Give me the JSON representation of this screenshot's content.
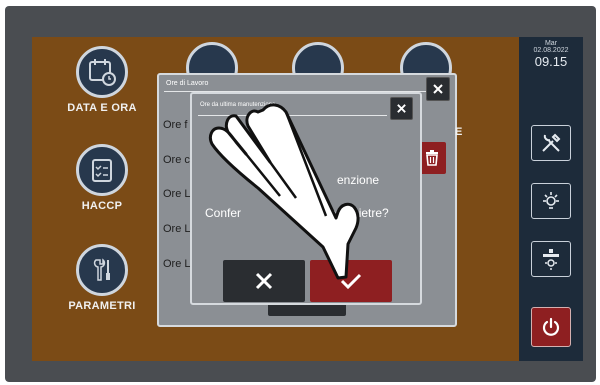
{
  "status": {
    "day": "Mar",
    "date": "02.08.2022",
    "time": "09.15"
  },
  "menu": {
    "date_time_label": "DATA E ORA",
    "haccp_label": "HACCP",
    "params_label": "PARAMETRI"
  },
  "dialog_hours": {
    "title": "Ore di Lavoro",
    "rows": [
      "Ore f",
      "Ore c",
      "Ore L",
      "Ore L",
      "Ore L"
    ],
    "bg_fragment": "E"
  },
  "dialog_confirm": {
    "title": "Ore da ultima manutenzione",
    "message_line1": "Confermi azzeramento ore manutenzione",
    "message_line1_visible": "enzione",
    "message_line2_left": "Confer",
    "message_line2_right": "sotto le pietre?"
  },
  "icons": {
    "calendar": "calendar-clock-icon",
    "checklist": "clipboard-checklist-icon",
    "tools": "wrench-screwdriver-icon",
    "tools_sidebar": "tools-icon",
    "light": "lamp-icon",
    "hood": "hood-light-icon",
    "power": "power-icon",
    "close": "close-icon",
    "trash": "trash-icon",
    "cancel": "x-icon",
    "confirm": "check-icon",
    "hand": "pointing-hand-icon"
  },
  "colors": {
    "background": "#7b4b16",
    "panel": "#8b8f94",
    "sidebar": "#1d2b3a",
    "accent_red": "#8e1f21",
    "dark_button": "#2a2d31"
  }
}
